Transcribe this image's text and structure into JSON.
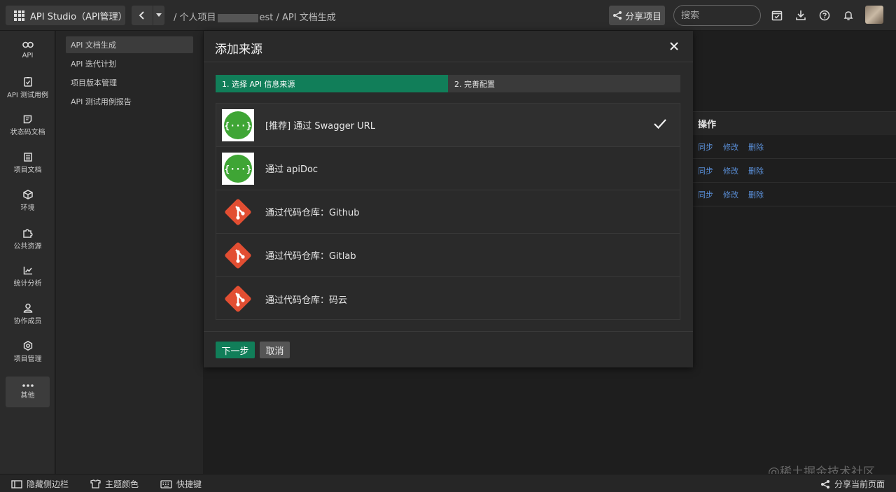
{
  "topbar": {
    "app_title": "API Studio（API管理）",
    "breadcrumb_prefix": "/ 个人项目",
    "breadcrumb_suffix": "est / API 文档生成",
    "share_label": "分享项目",
    "search_placeholder": "搜索"
  },
  "iconbar": {
    "items": [
      {
        "label": "API",
        "icon": "link-icon"
      },
      {
        "label": "API 测试用例",
        "icon": "clipboard-check-icon"
      },
      {
        "label": "状态码文档",
        "icon": "code-doc-icon"
      },
      {
        "label": "项目文档",
        "icon": "document-icon"
      },
      {
        "label": "环境",
        "icon": "cube-icon"
      },
      {
        "label": "公共资源",
        "icon": "puzzle-icon"
      },
      {
        "label": "统计分析",
        "icon": "chart-line-icon"
      },
      {
        "label": "协作成员",
        "icon": "user-icon"
      },
      {
        "label": "项目管理",
        "icon": "gear-icon"
      },
      {
        "label": "其他",
        "icon": "more-icon"
      }
    ]
  },
  "subnav": {
    "items": [
      {
        "label": "API 文档生成",
        "active": true
      },
      {
        "label": "API 迭代计划",
        "active": false
      },
      {
        "label": "项目版本管理",
        "active": false
      },
      {
        "label": "API 测试用例报告",
        "active": false
      }
    ]
  },
  "table": {
    "header": "操作",
    "rows": [
      {
        "sync": "同步",
        "edit": "修改",
        "delete": "删除"
      },
      {
        "sync": "同步",
        "edit": "修改",
        "delete": "删除"
      },
      {
        "sync": "同步",
        "edit": "修改",
        "delete": "删除"
      }
    ]
  },
  "modal": {
    "title": "添加来源",
    "steps": [
      {
        "label": "1. 选择 API 信息来源",
        "active": true
      },
      {
        "label": "2. 完善配置",
        "active": false
      }
    ],
    "sources": [
      {
        "label": "[推荐] 通过 Swagger URL",
        "icon": "swagger-icon",
        "selected": true
      },
      {
        "label": "通过 apiDoc",
        "icon": "swagger-icon",
        "selected": false
      },
      {
        "label": "通过代码仓库：Github",
        "icon": "git-icon",
        "selected": false
      },
      {
        "label": "通过代码仓库：Gitlab",
        "icon": "git-icon",
        "selected": false
      },
      {
        "label": "通过代码仓库：码云",
        "icon": "git-icon",
        "selected": false
      }
    ],
    "next_label": "下一步",
    "cancel_label": "取消"
  },
  "footer": {
    "hide_sidebar": "隐藏侧边栏",
    "theme_color": "主题颜色",
    "shortcuts": "快捷键",
    "share_page": "分享当前页面"
  },
  "watermark": "@稀土掘金技术社区",
  "colors": {
    "accent": "#117e59",
    "link": "#5a8fd8",
    "git": "#e24e32",
    "swagger": "#3fa535"
  }
}
